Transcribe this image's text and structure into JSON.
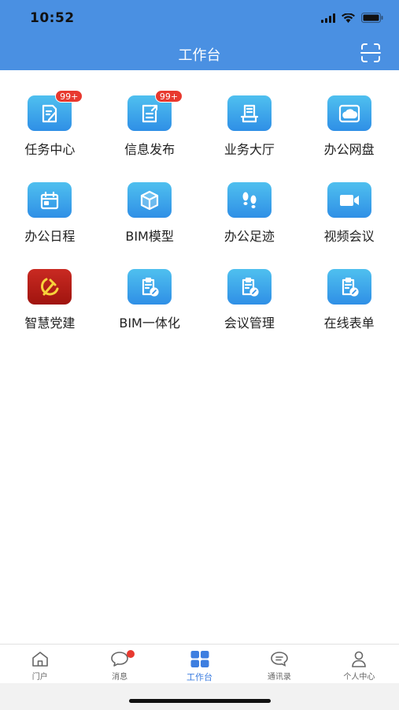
{
  "status_bar": {
    "time": "10:52"
  },
  "header": {
    "title": "工作台",
    "scan_icon": "scan-icon"
  },
  "apps": [
    {
      "label": "任务中心",
      "badge": "99+",
      "icon": "task-doc-icon"
    },
    {
      "label": "信息发布",
      "badge": "99+",
      "icon": "publish-icon"
    },
    {
      "label": "业务大厅",
      "badge": "",
      "icon": "hall-icon"
    },
    {
      "label": "办公网盘",
      "badge": "",
      "icon": "cloud-disk-icon"
    },
    {
      "label": "办公日程",
      "badge": "",
      "icon": "calendar-icon"
    },
    {
      "label": "BIM模型",
      "badge": "",
      "icon": "cube-icon"
    },
    {
      "label": "办公足迹",
      "badge": "",
      "icon": "footprint-icon"
    },
    {
      "label": "视频会议",
      "badge": "",
      "icon": "video-icon"
    },
    {
      "label": "智慧党建",
      "badge": "",
      "icon": "party-emblem-icon"
    },
    {
      "label": "BIM一体化",
      "badge": "",
      "icon": "form-edit-icon"
    },
    {
      "label": "会议管理",
      "badge": "",
      "icon": "form-edit-icon"
    },
    {
      "label": "在线表单",
      "badge": "",
      "icon": "form-edit-icon"
    }
  ],
  "tabbar": {
    "tabs": [
      {
        "label": "门户",
        "icon": "home-icon"
      },
      {
        "label": "消息",
        "icon": "chat-bubble-icon"
      },
      {
        "label": "工作台",
        "icon": "grid-icon"
      },
      {
        "label": "通讯录",
        "icon": "contacts-icon"
      },
      {
        "label": "个人中心",
        "icon": "user-icon"
      }
    ],
    "active": "工作台"
  },
  "colors": {
    "header": "#4a90e2",
    "accent": "#3d7ee0",
    "badge": "#e8392f",
    "party_red": "#b81d16"
  }
}
